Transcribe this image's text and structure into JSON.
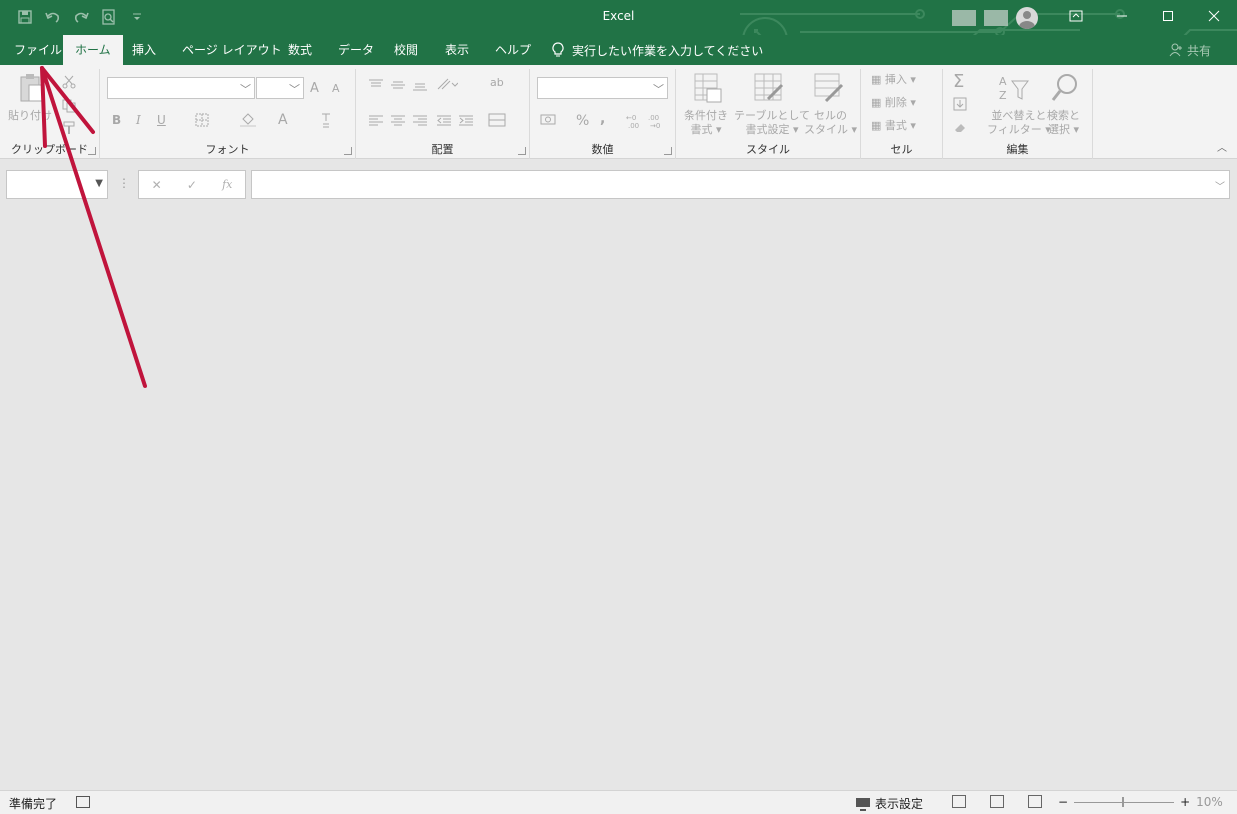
{
  "window": {
    "title": "Excel"
  },
  "tabs": [
    {
      "label": "ファイル"
    },
    {
      "label": "ホーム"
    },
    {
      "label": "挿入"
    },
    {
      "label": "ページ レイアウト"
    },
    {
      "label": "数式"
    },
    {
      "label": "データ"
    },
    {
      "label": "校閲"
    },
    {
      "label": "表示"
    },
    {
      "label": "ヘルプ"
    }
  ],
  "tell_me": "実行したい作業を入力してください",
  "share": "共有",
  "ribbon": {
    "clipboard": {
      "label": "クリップボード",
      "paste": "貼り付け"
    },
    "font": {
      "label": "フォント",
      "grow": "A",
      "shrink": "A",
      "bold": "B",
      "italic": "I",
      "underline": "U",
      "font_color": "A"
    },
    "alignment": {
      "label": "配置",
      "wrap": "ab"
    },
    "number": {
      "label": "数値",
      "percent": "%",
      "comma": ","
    },
    "styles": {
      "label": "スタイル",
      "conditional_1": "条件付き",
      "conditional_2": "書式",
      "table_1": "テーブルとして",
      "table_2": "書式設定",
      "cell_1": "セルの",
      "cell_2": "スタイル"
    },
    "cells": {
      "label": "セル",
      "insert": "挿入",
      "delete": "削除",
      "format": "書式"
    },
    "editing": {
      "label": "編集",
      "sum": "Σ",
      "sort_1": "並べ替えと",
      "sort_2": "フィルター",
      "find_1": "検索と",
      "find_2": "選択"
    }
  },
  "formula_bar": {
    "cancel": "✕",
    "enter": "✓",
    "fx": "fx"
  },
  "status": {
    "ready": "準備完了",
    "display_settings": "表示設定",
    "zoom": "10%"
  },
  "colors": {
    "brand": "#217346",
    "annotation": "#c0143c"
  }
}
